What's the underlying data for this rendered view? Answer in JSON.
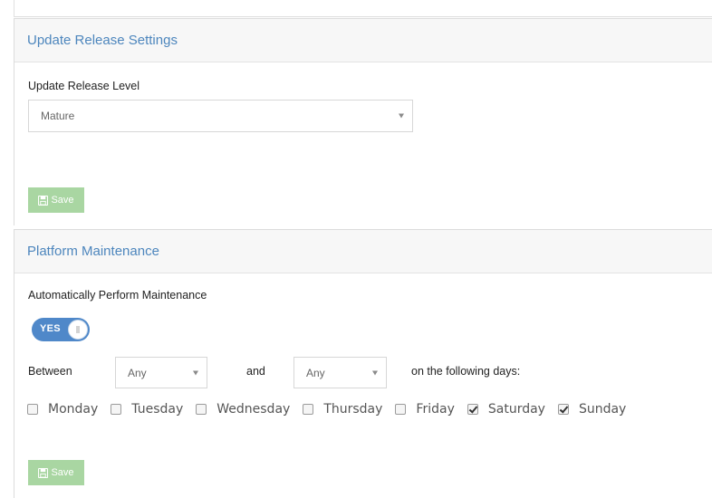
{
  "release_panel": {
    "title": "Update Release Settings",
    "level_label": "Update Release Level",
    "level_value": "Mature",
    "save_label": "Save"
  },
  "maintenance_panel": {
    "title": "Platform Maintenance",
    "auto_label": "Automatically Perform Maintenance",
    "toggle_label": "YES",
    "toggle_on": true,
    "between_label": "Between",
    "from_value": "Any",
    "and_label": "and",
    "to_value": "Any",
    "days_label": "on the following days:",
    "days": [
      {
        "label": "Monday",
        "checked": false
      },
      {
        "label": "Tuesday",
        "checked": false
      },
      {
        "label": "Wednesday",
        "checked": false
      },
      {
        "label": "Thursday",
        "checked": false
      },
      {
        "label": "Friday",
        "checked": false
      },
      {
        "label": "Saturday",
        "checked": true
      },
      {
        "label": "Sunday",
        "checked": true
      }
    ],
    "save_label": "Save"
  },
  "colors": {
    "title_blue": "#4d86bd",
    "save_green": "#a9d6a2",
    "toggle_blue": "#4f88c9"
  }
}
